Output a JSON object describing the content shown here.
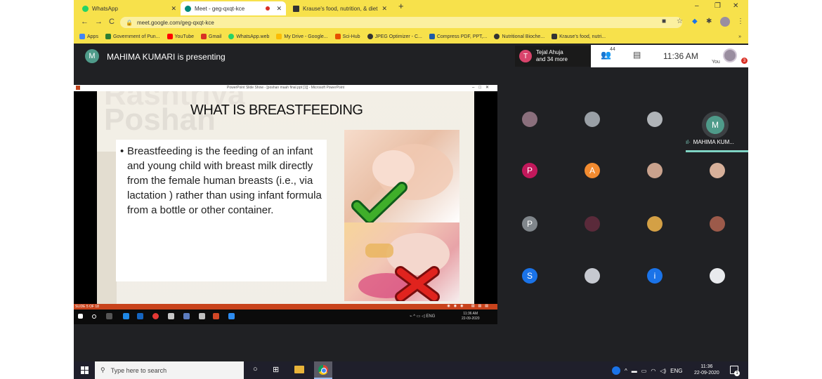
{
  "browser": {
    "tabs": [
      {
        "label": "WhatsApp",
        "icon": "whatsapp-icon",
        "color": "#25d366"
      },
      {
        "label": "Meet - geg-qxqt-kce",
        "icon": "meet-icon",
        "color": "#00897b"
      },
      {
        "label": "Krause's food, nutrition, & diet th",
        "icon": "book-icon",
        "color": "#333333"
      }
    ],
    "address": "meet.google.com/geg-qxqt-kce",
    "bookmarks": [
      {
        "label": "Apps",
        "color": "#4285f4"
      },
      {
        "label": "Government of Pun...",
        "color": "#2e7d32"
      },
      {
        "label": "YouTube",
        "color": "#ff0000"
      },
      {
        "label": "Gmail",
        "color": "#d93025"
      },
      {
        "label": "WhatsApp.web",
        "color": "#25d366"
      },
      {
        "label": "My Drive - Google...",
        "color": "#fbbc04"
      },
      {
        "label": "Sci-Hub",
        "color": "#e65100"
      },
      {
        "label": "JPEG Optimizer - C...",
        "color": "#333333"
      },
      {
        "label": "Compress PDF, PPT,...",
        "color": "#1e5aa8"
      },
      {
        "label": "Nutritional Bioche...",
        "color": "#333333"
      },
      {
        "label": "Krause's food, nutri...",
        "color": "#333333"
      }
    ],
    "more": "»"
  },
  "meet": {
    "presenter_initial": "M",
    "presenter_text": "MAHIMA KUMARI is presenting",
    "participant_card": {
      "initial": "T",
      "name": "Tejal Ahuja",
      "more": "and 34 more"
    },
    "people_count": "44",
    "time": "11:36 AM",
    "you_label": "You",
    "self_badge": "3"
  },
  "presentation": {
    "window_title": "PowerPoint Slide Show - [poshan maah final.ppt [1]] - Microsoft PowerPoint",
    "bg_word1": "Rashtriya",
    "bg_word2": "Poshan",
    "title": "WHAT IS BREASTFEEDING",
    "body": "Breastfeeding is the feeding of an infant and young child with breast milk directly from the female human breasts (i.e., via lactation ) rather than using infant formula from a bottle or other container.",
    "slide_number": "SLIDE 5 OF 18",
    "inner_time": "11:36 AM",
    "inner_date": "22-09-2020",
    "inner_lang": "ENG"
  },
  "grid": {
    "active_name": "MAHIMA KUM...",
    "tiles": [
      {
        "label": "",
        "color": "#8a6f7c"
      },
      {
        "label": "",
        "color": "#9aa0a6"
      },
      {
        "label": "",
        "color": "#b0b4b8"
      },
      {
        "label": "M",
        "color": "#4f9b8a"
      },
      {
        "label": "P",
        "color": "#c2185b"
      },
      {
        "label": "A",
        "color": "#f28b30"
      },
      {
        "label": "",
        "color": "#c9a28d"
      },
      {
        "label": "",
        "color": "#d7b09a"
      },
      {
        "label": "P",
        "color": "#80868b"
      },
      {
        "label": "",
        "color": "#5a2a3a"
      },
      {
        "label": "",
        "color": "#d4a045"
      },
      {
        "label": "",
        "color": "#9c5a4a"
      },
      {
        "label": "S",
        "color": "#1a73e8"
      },
      {
        "label": "",
        "color": "#c6c9d0"
      },
      {
        "label": "i",
        "color": "#1a73e8"
      },
      {
        "label": "",
        "color": "#e8eaed"
      }
    ]
  },
  "taskbar": {
    "search_placeholder": "Type here to search",
    "lang": "ENG",
    "time": "11:36",
    "date": "22-09-2020",
    "notifications": "1"
  }
}
